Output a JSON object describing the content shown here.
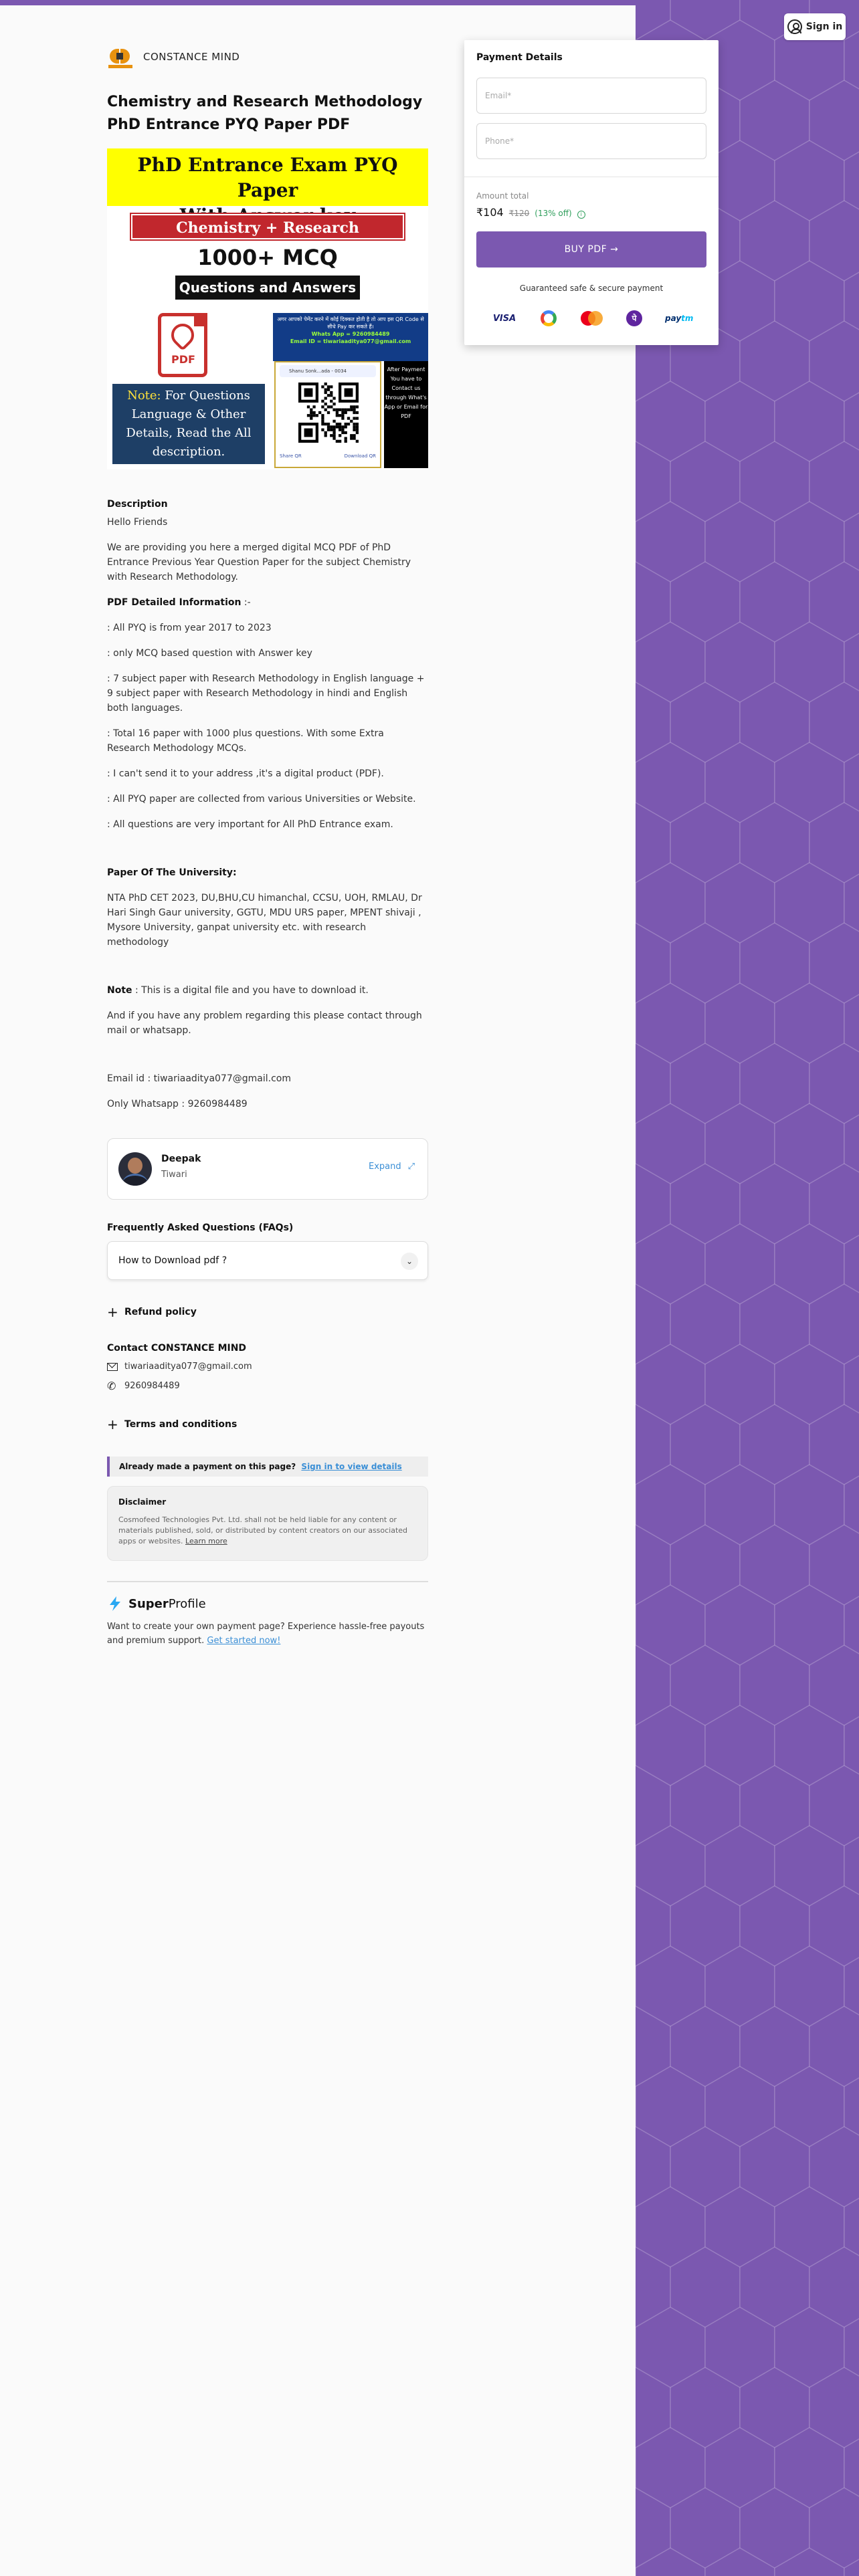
{
  "header": {
    "sign_in_label": "Sign in"
  },
  "brand": {
    "name": "CONSTANCE MIND"
  },
  "product": {
    "title": "Chemistry and Research Methodology PhD Entrance PYQ Paper PDF"
  },
  "banner": {
    "headline_1": "PhD Entrance Exam PYQ Paper",
    "headline_2": "With Answer key",
    "subject": "Chemistry + Research Methodology",
    "mcq": "1000+ MCQ",
    "qa": "Questions and Answers PDF",
    "pdf_label": "PDF",
    "note_prefix": "Note:",
    "note_text": "For Questions Language & Other Details, Read the All description.",
    "qr_top_hindi": "अगर आपको पेमेंट करने में कोई दिक्कत होती है तो आप इस QR Code से सीधे Pay कर सकते हैं।",
    "qr_whatsapp": "Whats App = 9260984489",
    "qr_email": "Email ID = tiwariaaditya077@gmail.com",
    "qr_bar": "Shanu Sonk...ada - 0034",
    "qr_side": "After Payment You have to Contact us through What's App or Email for PDF",
    "qr_foot_left": "Share QR",
    "qr_foot_right": "Download QR"
  },
  "description": {
    "heading": "Description",
    "greeting": "Hello Friends",
    "intro": "We are providing you here a merged digital MCQ PDF of PhD Entrance Previous Year Question Paper for the subject Chemistry with Research Methodology.",
    "pdf_info_heading": "PDF Detailed Information",
    "pdf_info_suffix": " :-",
    "points": [
      ": All PYQ is from year 2017 to 2023",
      ": only MCQ based question with Answer key",
      ": 7 subject paper with Research Methodology in English language + 9 subject paper with Research Methodology in hindi and English both languages.",
      ": Total 16 paper with 1000 plus questions. With some Extra Research Methodology MCQs.",
      ": I can't send it to your address ,it's a digital product (PDF).",
      ": All PYQ paper are collected from various Universities or Website.",
      ": All questions are very important for All PhD Entrance exam."
    ],
    "university_heading": "Paper Of The University:",
    "university_text": "NTA PhD CET 2023, DU,BHU,CU himanchal, CCSU, UOH, RMLAU, Dr Hari Singh Gaur university, GGTU, MDU URS paper, MPENT shivaji , Mysore University, ganpat university etc. with research methodology",
    "note_label": "Note",
    "note_text": " : This is a digital file and you have to download it.",
    "problem_text": "And if you have any problem regarding this please contact through mail or whatsapp.",
    "email_line": "Email id : tiwariaaditya077@gmail.com",
    "whatsapp_line": "Only Whatsapp : 9260984489"
  },
  "creator": {
    "first_name": "Deepak",
    "last_name": "Tiwari",
    "expand_label": "Expand"
  },
  "faq": {
    "heading": "Frequently Asked Questions (FAQs)",
    "items": [
      {
        "question": "How to Download pdf ?"
      }
    ]
  },
  "refund": {
    "label": "Refund policy"
  },
  "contact": {
    "heading": "Contact CONSTANCE MIND",
    "email": "tiwariaaditya077@gmail.com",
    "phone": "9260984489"
  },
  "terms": {
    "label": "Terms and conditions"
  },
  "already_paid": {
    "text": "Already made a payment on this page?",
    "link": "Sign in to view details"
  },
  "disclaimer": {
    "heading": "Disclaimer",
    "text": "Cosmofeed Technologies Pvt. Ltd. shall not be held liable for any content or materials published, sold, or distributed by content creators on our associated apps or websites.",
    "link": "Learn more"
  },
  "superprofile": {
    "brand_bold": "Super",
    "brand_rest": "Profile",
    "text": "Want to create your own payment page? Experience hassle-free payouts and premium support.",
    "link": "Get started now!"
  },
  "payment": {
    "heading": "Payment Details",
    "email_placeholder": "Email*",
    "phone_placeholder": "Phone*",
    "amount_label": "Amount total",
    "price": "₹104",
    "original_price": "₹120",
    "discount": "(13% off)",
    "buy_label": "BUY PDF",
    "guarantee": "Guaranteed safe & secure payment",
    "methods": [
      "VISA",
      "Google Pay",
      "Mastercard",
      "PhonePe",
      "Paytm"
    ]
  },
  "colors": {
    "accent": "#7b58b0",
    "link": "#3b8fd6",
    "discount": "#2e9e5b"
  }
}
